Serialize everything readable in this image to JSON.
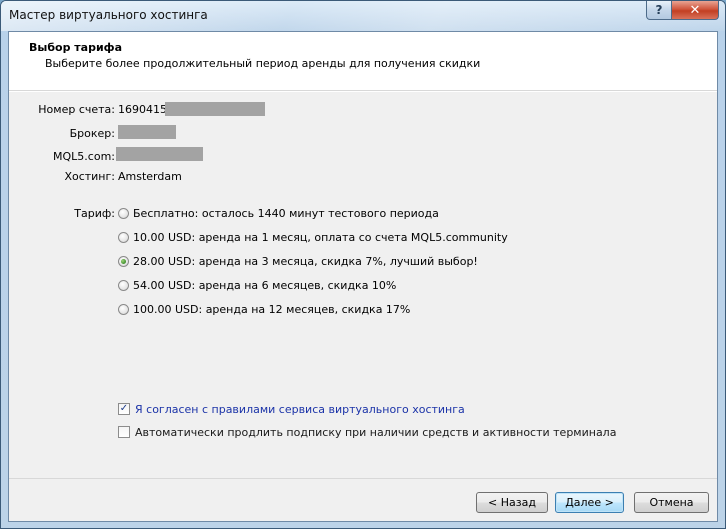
{
  "window": {
    "title": "Мастер виртуального хостинга",
    "help_glyph": "?",
    "close_glyph": "✕"
  },
  "header": {
    "title": "Выбор тарифа",
    "subtitle": "Выберите более продолжительный период аренды для получения скидки"
  },
  "info": {
    "account_label": "Номер счета:",
    "account_value": "1690415,",
    "broker_label": "Брокер:",
    "mql5_label": "MQL5.com:",
    "hosting_label": "Хостинг:",
    "hosting_value": "Amsterdam"
  },
  "tariff": {
    "label": "Тариф:",
    "selected_index": 2,
    "options": [
      "Бесплатно: осталось 1440 минут тестового периода",
      "10.00 USD: аренда на 1 месяц, оплата со счета MQL5.community",
      "28.00 USD: аренда на 3 месяца, скидка 7%, лучший выбор!",
      "54.00 USD: аренда на 6 месяцев, скидка 10%",
      "100.00 USD: аренда на 12 месяцев, скидка 17%"
    ]
  },
  "agreements": {
    "rules_label": "Я согласен с правилами сервиса виртуального хостинга",
    "rules_checked": true,
    "autorenew_label": "Автоматически продлить подписку при наличии средств и активности терминала",
    "autorenew_checked": false,
    "check_glyph": "✓"
  },
  "buttons": {
    "back": "< Назад",
    "next": "Далее >",
    "cancel": "Отмена"
  },
  "colors": {
    "link_blue": "#1b33a8",
    "default_button_border": "#3c7fb1",
    "redaction_gray": "#a3a3a3"
  }
}
